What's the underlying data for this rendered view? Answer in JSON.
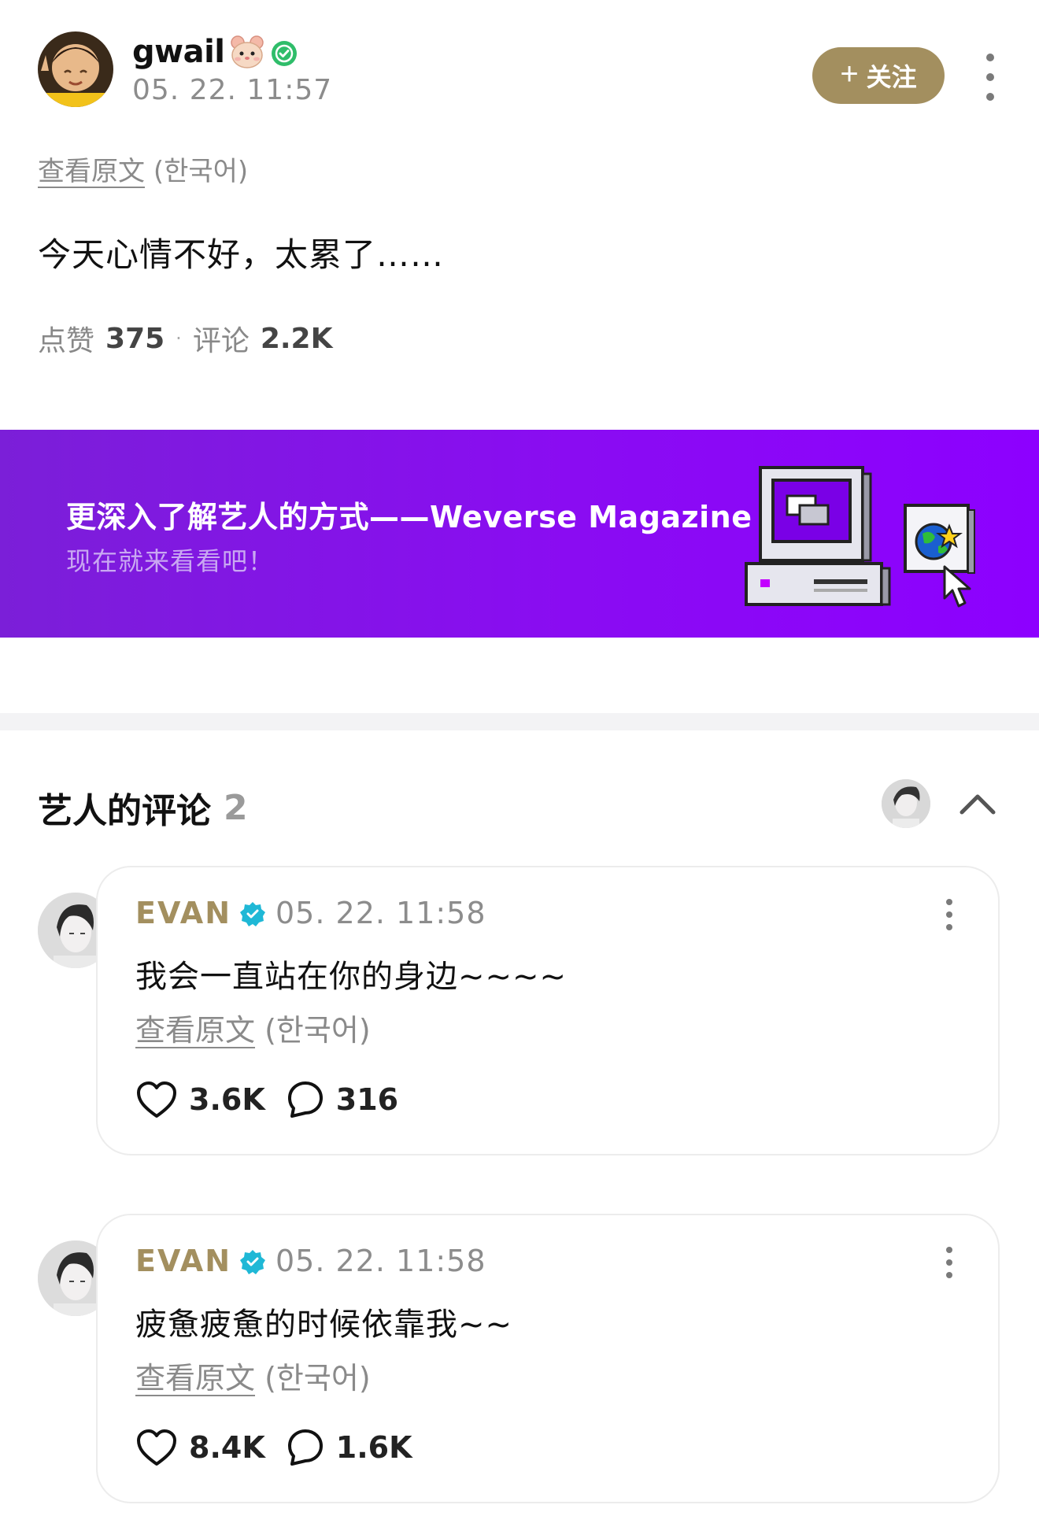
{
  "post": {
    "author": "gwail",
    "timestamp": "05. 22. 11:57",
    "follow_label": "关注",
    "translate_link": "查看原文",
    "translate_lang": "(한국어)",
    "text": "今天心情不好，太累了……",
    "likes_label": "点赞",
    "likes_count": "375",
    "comments_label": "评论",
    "comments_count": "2.2K"
  },
  "banner": {
    "title": "更深入了解艺人的方式——Weverse Magazine",
    "subtitle": "现在就来看看吧！"
  },
  "artist_comments": {
    "title": "艺人的评论",
    "count": "2",
    "items": [
      {
        "name": "EVAN",
        "timestamp": "05. 22. 11:58",
        "text": "我会一直站在你的身边~~~~",
        "translate_link": "查看原文",
        "translate_lang": "(한국어)",
        "likes": "3.6K",
        "replies": "316"
      },
      {
        "name": "EVAN",
        "timestamp": "05. 22. 11:58",
        "text": "疲惫疲惫的时候依靠我~~",
        "translate_link": "查看原文",
        "translate_lang": "(한국어)",
        "likes": "8.4K",
        "replies": "1.6K"
      }
    ]
  },
  "colors": {
    "gold_accent": "#a38f5f",
    "banner_purple": "#8a0cf2",
    "verified_green": "#2fbd6a",
    "verified_cyan": "#1fb8d6"
  }
}
